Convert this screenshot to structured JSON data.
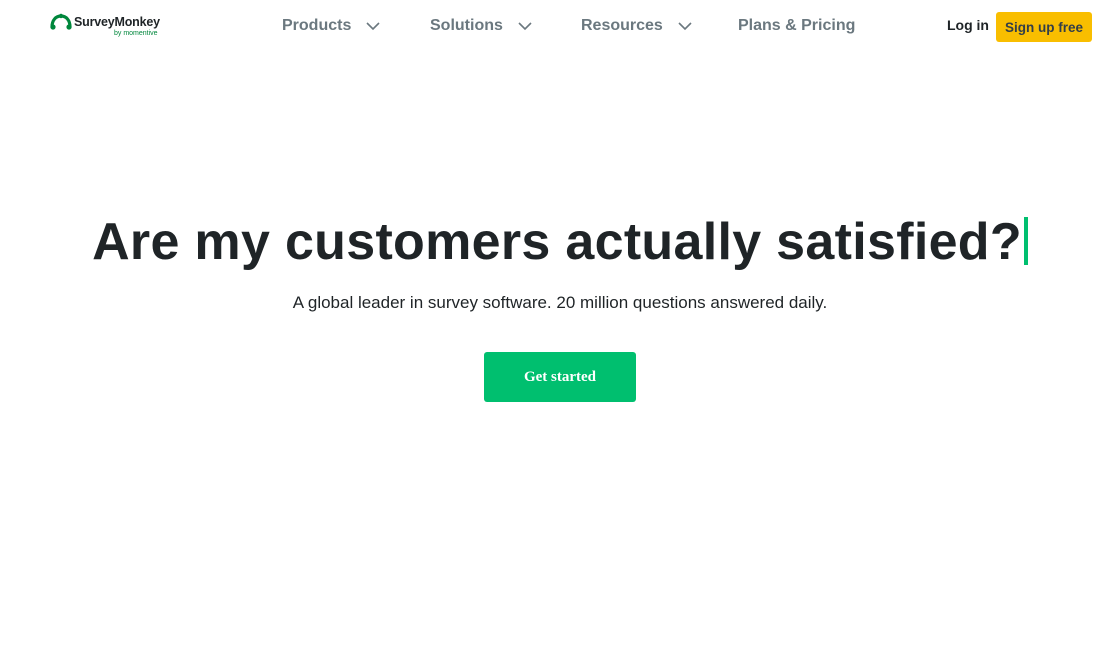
{
  "header": {
    "logo": {
      "name": "SurveyMonkey",
      "trademark": "·",
      "tagline": "by momentive"
    },
    "nav": [
      {
        "label": "Products",
        "has_dropdown": true
      },
      {
        "label": "Solutions",
        "has_dropdown": true
      },
      {
        "label": "Resources",
        "has_dropdown": true
      },
      {
        "label": "Plans & Pricing",
        "has_dropdown": false
      }
    ],
    "login_label": "Log in",
    "signup_label": "Sign up free"
  },
  "hero": {
    "title": "Are my customers actually satisfied?",
    "subtitle": "A global leader in survey software. 20 million questions answered daily.",
    "cta_label": "Get started"
  },
  "colors": {
    "brand_green": "#00bf6f",
    "logo_green": "#00873c",
    "signup_yellow": "#f9be00",
    "nav_text": "#6b787f",
    "heading_text": "#1f2427"
  },
  "icons": {
    "logo_mark": "surveymonkey-logo-icon",
    "dropdown": "chevron-down-icon"
  }
}
